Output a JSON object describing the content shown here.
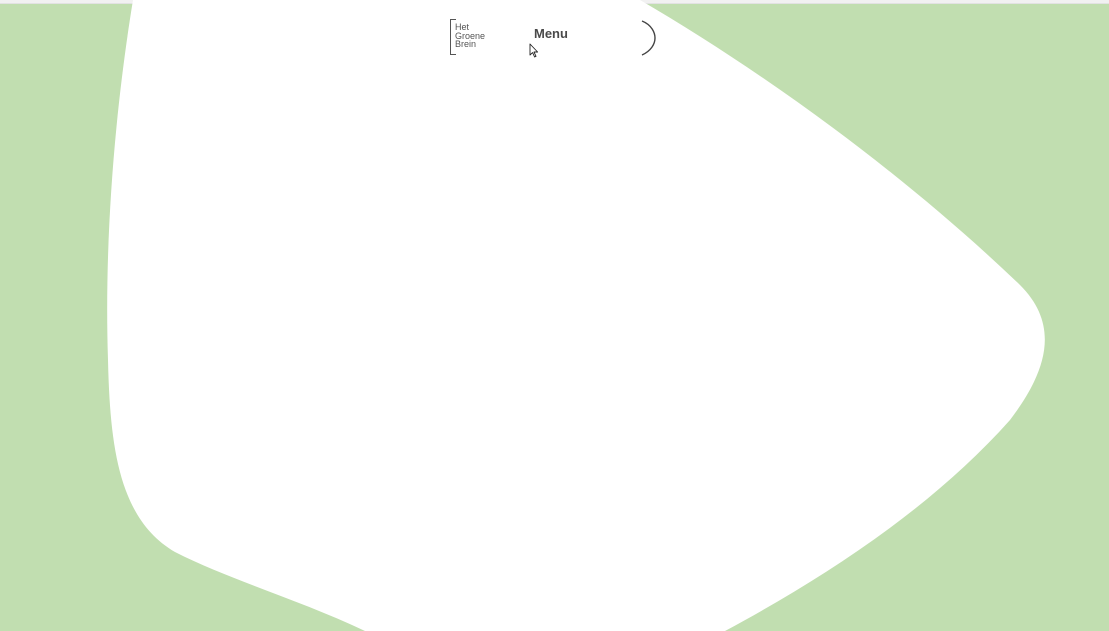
{
  "brand": {
    "logo_lines": [
      "Het",
      "Groene",
      "Brein"
    ]
  },
  "nav": {
    "menu_label": "Menu"
  },
  "colors": {
    "background_green": "#c1deb0",
    "shape_white": "#ffffff",
    "text_dark": "#4a4a4a"
  },
  "icons": {
    "close": "close-arc-icon",
    "cursor": "mouse-pointer-icon"
  }
}
